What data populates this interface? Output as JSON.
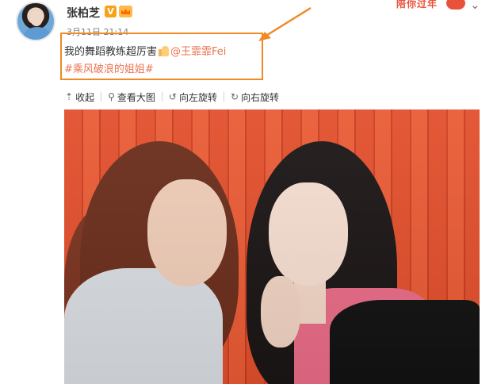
{
  "user": {
    "name": "张柏芝",
    "verified_icon": "verified-v-icon",
    "member_icon": "crown-icon",
    "timestamp": "3月11日 21:14"
  },
  "promo": {
    "text": "陪你过年",
    "icon": "heart-icon"
  },
  "menu": {
    "icon": "chevron-down-icon"
  },
  "post": {
    "text": "我的舞蹈教练超厉害",
    "emoji": "thumbs-up-icon",
    "mention": "@王霏霏Fei",
    "hashtag": "#乘风破浪的姐姐#"
  },
  "annotation": {
    "box_color": "#f08a24",
    "arrow_color": "#f08a24"
  },
  "toolbar": {
    "collapse": {
      "label": "收起",
      "icon": "arrow-up-icon"
    },
    "view_large": {
      "label": "查看大图",
      "icon": "search-icon"
    },
    "rotate_left": {
      "label": "向左旋转",
      "icon": "rotate-left-icon"
    },
    "rotate_right": {
      "label": "向右旋转",
      "icon": "rotate-right-icon"
    }
  },
  "colors": {
    "link": "#eb7350",
    "text": "#333333",
    "meta": "#808080",
    "background_orange": "#e24f2c"
  }
}
